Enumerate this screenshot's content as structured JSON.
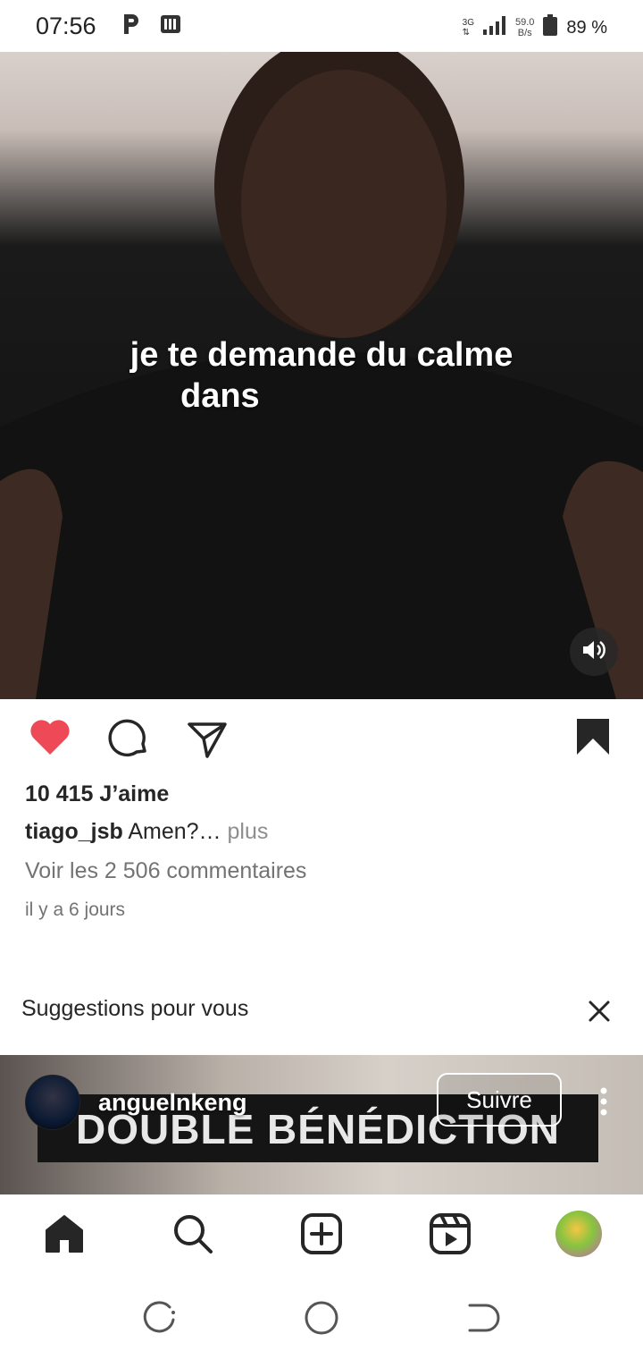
{
  "status_bar": {
    "time": "07:56",
    "network_type": "3G",
    "net_speed_value": "59.0",
    "net_speed_unit": "B/s",
    "battery": "89 %"
  },
  "post": {
    "caption_line1": "je te demande du calme",
    "caption_line2": "dans",
    "likes": "10 415 J’aime",
    "username": "tiago_jsb",
    "text": "Amen?…",
    "more": "plus",
    "comments_link": "Voir les 2 506 commentaires",
    "date": "il y a 6 jours",
    "liked": true,
    "saved": true
  },
  "suggestions": {
    "title": "Suggestions pour vous"
  },
  "next_post": {
    "username": "anguelnkeng",
    "follow_label": "Suivre",
    "banner_text": "DOUBLE BÉNÉDICTION"
  },
  "colors": {
    "like": "#ed4956",
    "text": "#262626",
    "secondary": "#737373"
  },
  "nav": {
    "items": [
      "home-icon",
      "search-icon",
      "create-icon",
      "reels-icon",
      "profile-avatar"
    ]
  }
}
